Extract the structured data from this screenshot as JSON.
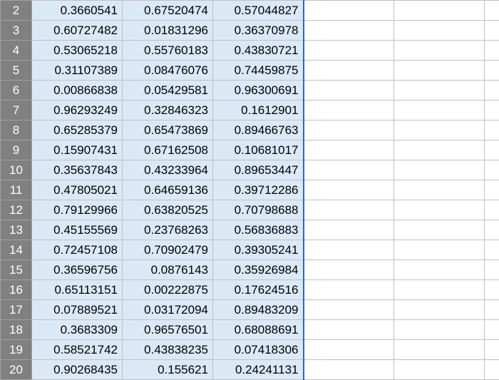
{
  "grid": {
    "visible_row_start": 2,
    "visible_row_end": 20,
    "selected_columns": [
      0,
      1,
      2
    ],
    "data": {
      "2": [
        "0.3660541",
        "0.67520474",
        "0.57044827"
      ],
      "3": [
        "0.60727482",
        "0.01831296",
        "0.36370978"
      ],
      "4": [
        "0.53065218",
        "0.55760183",
        "0.43830721"
      ],
      "5": [
        "0.31107389",
        "0.08476076",
        "0.74459875"
      ],
      "6": [
        "0.00866838",
        "0.05429581",
        "0.96300691"
      ],
      "7": [
        "0.96293249",
        "0.32846323",
        "0.1612901"
      ],
      "8": [
        "0.65285379",
        "0.65473869",
        "0.89466763"
      ],
      "9": [
        "0.15907431",
        "0.67162508",
        "0.10681017"
      ],
      "10": [
        "0.35637843",
        "0.43233964",
        "0.89653447"
      ],
      "11": [
        "0.47805021",
        "0.64659136",
        "0.39712286"
      ],
      "12": [
        "0.79129966",
        "0.63820525",
        "0.70798688"
      ],
      "13": [
        "0.45155569",
        "0.23768263",
        "0.56836883"
      ],
      "14": [
        "0.72457108",
        "0.70902479",
        "0.39305241"
      ],
      "15": [
        "0.36596756",
        "0.0876143",
        "0.35926984"
      ],
      "16": [
        "0.65113151",
        "0.00222875",
        "0.17624516"
      ],
      "17": [
        "0.07889521",
        "0.03172094",
        "0.89483209"
      ],
      "18": [
        "0.3683309",
        "0.96576501",
        "0.68088691"
      ],
      "19": [
        "0.58521742",
        "0.43838235",
        "0.07418306"
      ],
      "20": [
        "0.90268435",
        "0.155621",
        "0.24241131"
      ]
    },
    "empty_columns_after": 3
  }
}
